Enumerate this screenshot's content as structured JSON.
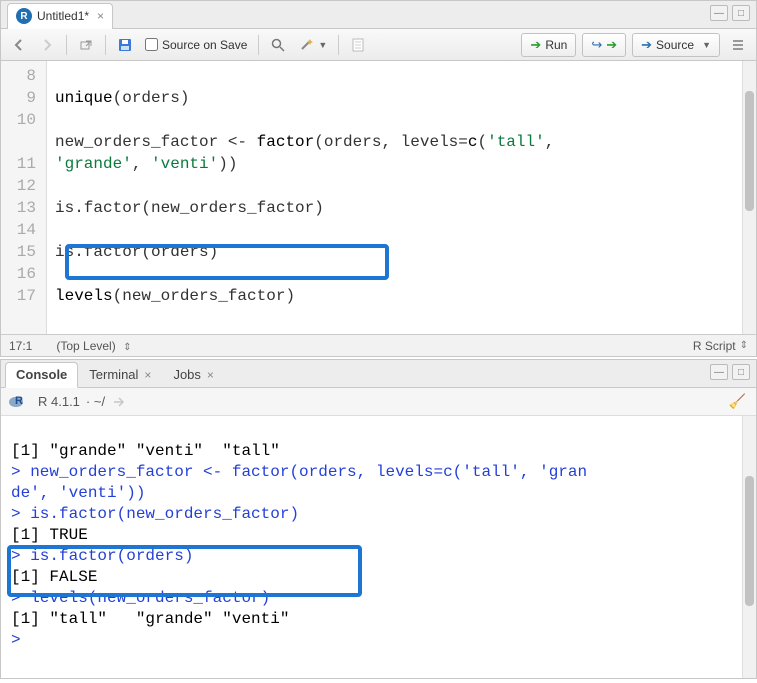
{
  "editor": {
    "tab_title": "Untitled1*",
    "toolbar": {
      "source_on_save": "Source on Save",
      "run": "Run",
      "source": "Source"
    },
    "gutter_start": 8,
    "gutter_end": 17,
    "code": {
      "l8": "unique(orders)",
      "l9": "",
      "l10": "new_orders_factor <- factor(orders, levels=c('tall',",
      "l10b": "'grande', 'venti'))",
      "l11": "",
      "l12": "is.factor(new_orders_factor)",
      "l13": "",
      "l14": "is.factor(orders)",
      "l15": "",
      "l16": "levels(new_orders_factor)",
      "l17": ""
    },
    "status": {
      "pos": "17:1",
      "scope": "(Top Level)",
      "lang": "R Script"
    }
  },
  "console": {
    "tabs": {
      "console": "Console",
      "terminal": "Terminal",
      "jobs": "Jobs"
    },
    "r_version": "R 4.1.1",
    "r_path": "· ~/",
    "lines": {
      "o1": "[1] \"grande\" \"venti\"  \"tall\"",
      "i1a": "> new_orders_factor <- factor(orders, levels=c('tall', 'gran",
      "i1b": "de', 'venti'))",
      "i2": "> is.factor(new_orders_factor)",
      "o2": "[1] TRUE",
      "i3": "> is.factor(orders)",
      "o3": "[1] FALSE",
      "i4": "> levels(new_orders_factor)",
      "o4": "[1] \"tall\"   \"grande\" \"venti\"",
      "i5": "> "
    }
  }
}
